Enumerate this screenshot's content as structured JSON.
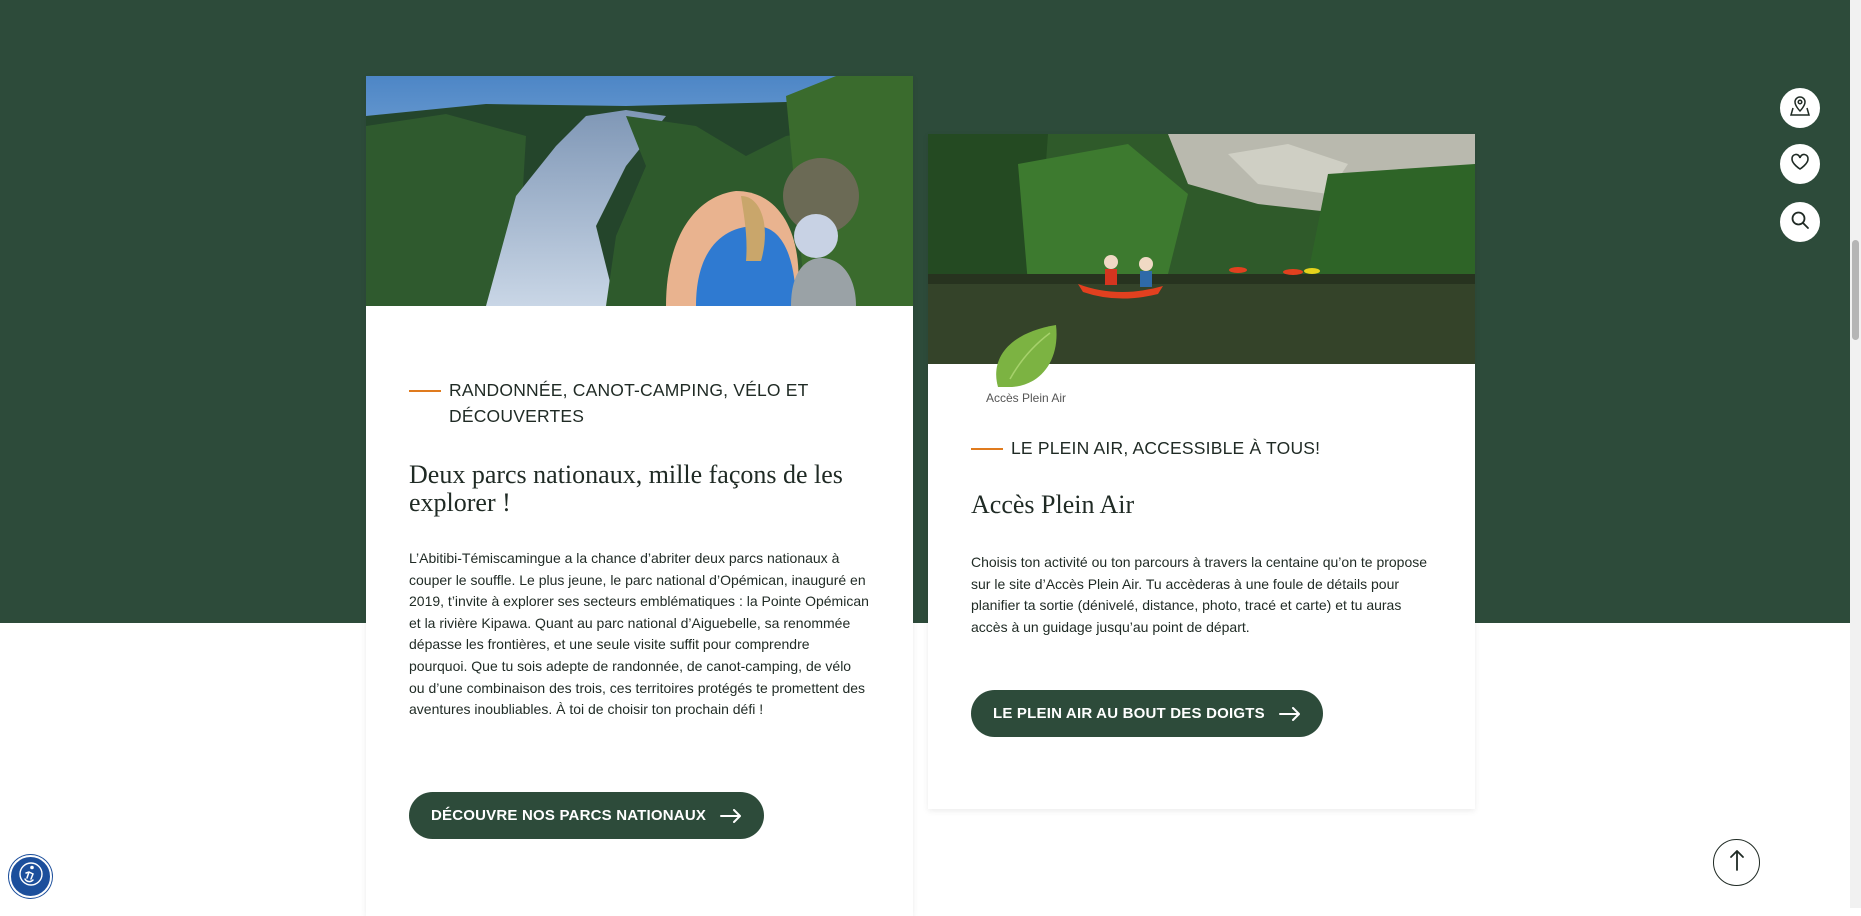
{
  "card_parks": {
    "eyebrow": "RANDONNÉE, CANOT-CAMPING, VÉLO ET DÉCOUVERTES",
    "title": "Deux parcs nationaux, mille façons de les explorer !",
    "body": "L’Abitibi-Témiscamingue a la chance d’abriter deux parcs nationaux à couper le souffle. Le plus jeune, le parc national d’Opémican, inauguré en 2019, t’invite à explorer ses secteurs emblématiques : la Pointe Opémican et la rivière Kipawa. Quant au parc national d’Aiguebelle, sa renommée dépasse les frontières, et une seule visite suffit pour comprendre pourquoi. Que tu sois adepte de randonnée, de canot-camping, de vélo ou d’une combinaison des trois, ces territoires protégés te promettent des aventures inoubliables. À toi de choisir ton prochain défi !",
    "cta": "DÉCOUVRE NOS PARCS NATIONAUX"
  },
  "card_access": {
    "badge_label": "Accès Plein Air",
    "eyebrow": "LE PLEIN AIR, ACCESSIBLE À TOUS!",
    "title": "Accès Plein Air",
    "body": "Choisis ton activité ou ton parcours à travers la centaine qu’on te propose sur le site d’Accès Plein Air. Tu accèderas à une foule de détails pour planifier ta sortie (dénivelé, distance, photo, tracé et carte) et tu auras accès à un guidage jusqu’au point de départ.",
    "cta": "LE PLEIN AIR AU BOUT DES DOIGTS"
  },
  "side_actions": [
    {
      "icon": "map-pin-icon"
    },
    {
      "icon": "heart-icon"
    },
    {
      "icon": "search-icon"
    }
  ],
  "colors": {
    "brand_green": "#2d4b3a",
    "accent_orange": "#e07b1e",
    "leaf_green": "#7cb342",
    "a11y_blue": "#1c4f9c"
  }
}
